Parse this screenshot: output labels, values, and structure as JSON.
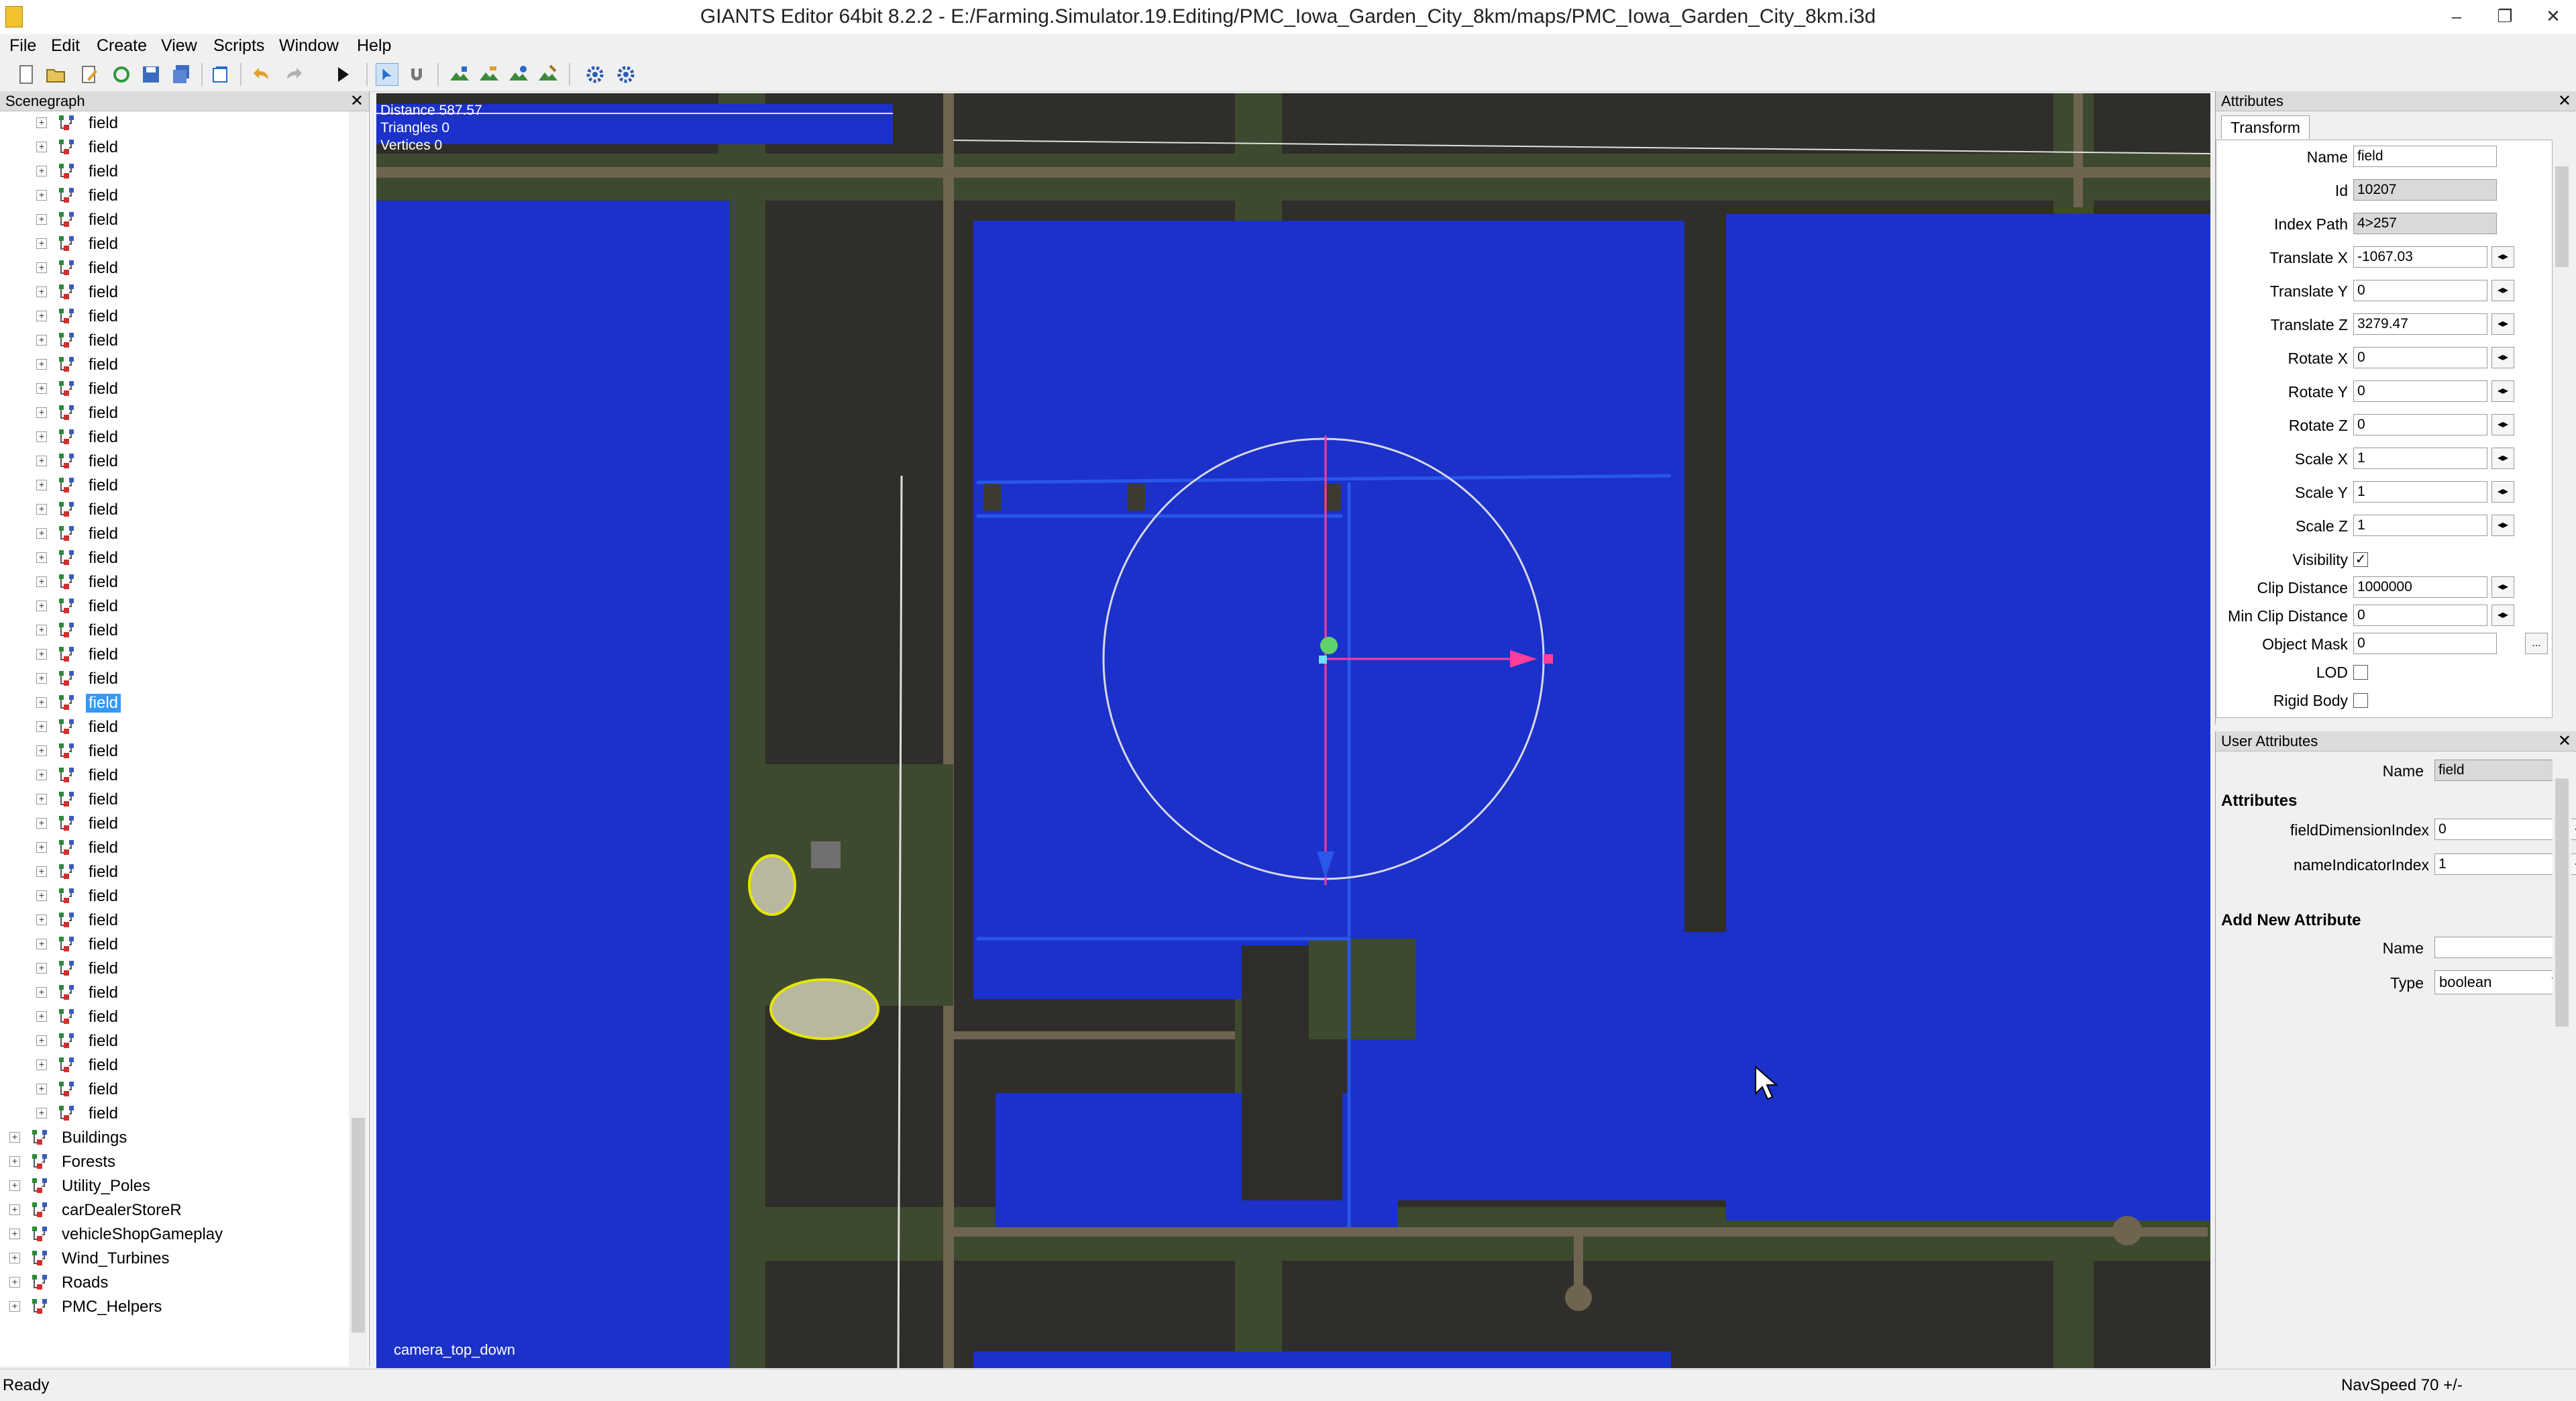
{
  "window": {
    "title": "GIANTS Editor 64bit 8.2.2 - E:/Farming.Simulator.19.Editing/PMC_Iowa_Garden_City_8km/maps/PMC_Iowa_Garden_City_8km.i3d",
    "minimize": "–",
    "restore": "❐",
    "close": "✕"
  },
  "menu": [
    "File",
    "Edit",
    "Create",
    "View",
    "Scripts",
    "Window",
    "Help"
  ],
  "scenegraph": {
    "title": "Scenegraph",
    "field_label": "field",
    "selected_index": 24,
    "groups": [
      "Buildings",
      "Forests",
      "Utility_Poles",
      "carDealerStoreR",
      "vehicleShopGameplay",
      "Wind_Turbines",
      "Roads",
      "PMC_Helpers"
    ]
  },
  "viewport": {
    "distance": "Distance 587.57",
    "triangles": "Triangles 0",
    "vertices": "Vertices 0",
    "camera": "camera_top_down",
    "colors": {
      "field": "#1b31c9",
      "ground": "#2f2e2a",
      "road": "#6e6450",
      "grass": "#3d4a2f"
    }
  },
  "attributes": {
    "title": "Attributes",
    "tab": "Transform",
    "rows": [
      {
        "label": "Name",
        "value": "field",
        "kind": "text"
      },
      {
        "label": "Id",
        "value": "10207",
        "kind": "ro"
      },
      {
        "label": "Index Path",
        "value": "4>257",
        "kind": "ro"
      },
      {
        "label": "Translate X",
        "value": "-1067.03",
        "kind": "spin"
      },
      {
        "label": "Translate Y",
        "value": "0",
        "kind": "spin"
      },
      {
        "label": "Translate Z",
        "value": "3279.47",
        "kind": "spin"
      },
      {
        "label": "Rotate X",
        "value": "0",
        "kind": "spin"
      },
      {
        "label": "Rotate Y",
        "value": "0",
        "kind": "spin"
      },
      {
        "label": "Rotate Z",
        "value": "0",
        "kind": "spin"
      },
      {
        "label": "Scale X",
        "value": "1",
        "kind": "spin"
      },
      {
        "label": "Scale Y",
        "value": "1",
        "kind": "spin"
      },
      {
        "label": "Scale Z",
        "value": "1",
        "kind": "spin"
      },
      {
        "label": "Visibility",
        "value": "✓",
        "kind": "check"
      },
      {
        "label": "Clip Distance",
        "value": "1000000",
        "kind": "spin"
      },
      {
        "label": "Min Clip Distance",
        "value": "0",
        "kind": "spin"
      },
      {
        "label": "Object Mask",
        "value": "0",
        "kind": "more"
      },
      {
        "label": "LOD",
        "value": "",
        "kind": "check"
      },
      {
        "label": "Rigid Body",
        "value": "",
        "kind": "check"
      }
    ],
    "more_button": "..."
  },
  "user_attributes": {
    "title": "User Attributes",
    "name_label": "Name",
    "name_value": "field",
    "section_attributes": "Attributes",
    "attrs": [
      {
        "label": "fieldDimensionIndex",
        "value": "0"
      },
      {
        "label": "nameIndicatorIndex",
        "value": "1"
      }
    ],
    "section_add": "Add New Attribute",
    "new_name_label": "Name",
    "new_name_value": "",
    "type_label": "Type",
    "type_value": "boolean"
  },
  "status": {
    "left": "Ready",
    "right": "NavSpeed 70 +/-"
  }
}
